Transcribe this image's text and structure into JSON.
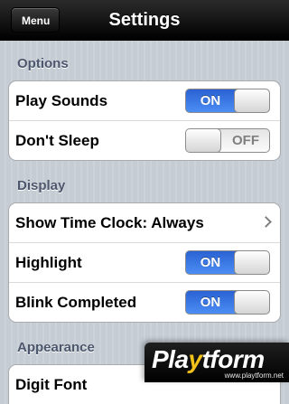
{
  "navbar": {
    "back_label": "Menu",
    "title": "Settings"
  },
  "sections": [
    {
      "header": "Options",
      "rows": [
        {
          "label": "Play Sounds",
          "type": "switch",
          "state": "ON"
        },
        {
          "label": "Don't Sleep",
          "type": "switch",
          "state": "OFF"
        }
      ]
    },
    {
      "header": "Display",
      "rows": [
        {
          "label": "Show Time Clock: Always",
          "type": "disclosure"
        },
        {
          "label": "Highlight",
          "type": "switch",
          "state": "ON"
        },
        {
          "label": "Blink Completed",
          "type": "switch",
          "state": "ON"
        }
      ]
    },
    {
      "header": "Appearance",
      "rows": [
        {
          "label": "Digit Font",
          "type": "disclosure"
        }
      ]
    }
  ],
  "colors": {
    "switch_on": "#2a62d3",
    "section_header": "#4c566c",
    "background": "#c5ccd4"
  },
  "watermark": {
    "logo_pre": "Pla",
    "logo_y": "y",
    "logo_post": "tform",
    "url": "www.playtform.net"
  }
}
